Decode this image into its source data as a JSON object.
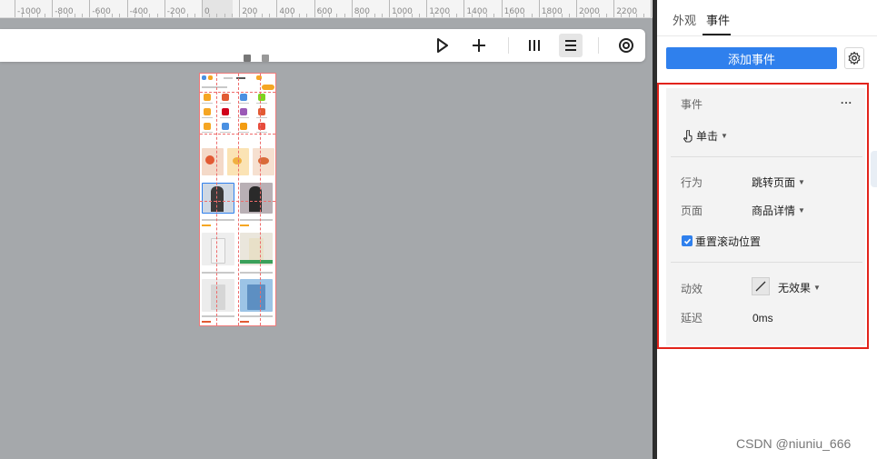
{
  "ruler": {
    "labels": [
      "-1000",
      "-800",
      "-600",
      "-400",
      "-200",
      "0",
      "200",
      "400",
      "600",
      "800",
      "1000",
      "1200",
      "1400",
      "1600",
      "1800",
      "2000",
      "2200",
      "24"
    ]
  },
  "toolbar": {
    "buttons": [
      "play",
      "add",
      "columns",
      "list",
      "target"
    ],
    "active": "list"
  },
  "panel": {
    "tabs": [
      "外观",
      "事件"
    ],
    "active_tab": "事件",
    "add_event_label": "添加事件",
    "event": {
      "title": "事件",
      "more_label": "...",
      "trigger": "单击",
      "action_label": "行为",
      "action_value": "跳转页面",
      "page_label": "页面",
      "page_value": "商品详情",
      "reset_scroll_label": "重置滚动位置",
      "reset_scroll_checked": true,
      "anim_label": "动效",
      "anim_value": "无效果",
      "delay_label": "延迟",
      "delay_value": "0ms"
    }
  },
  "watermark": "CSDN @niuniu_666",
  "colors": {
    "accent": "#2f80ed",
    "highlight_border": "#e2231a",
    "canvas_bg": "#a5a8ab"
  }
}
